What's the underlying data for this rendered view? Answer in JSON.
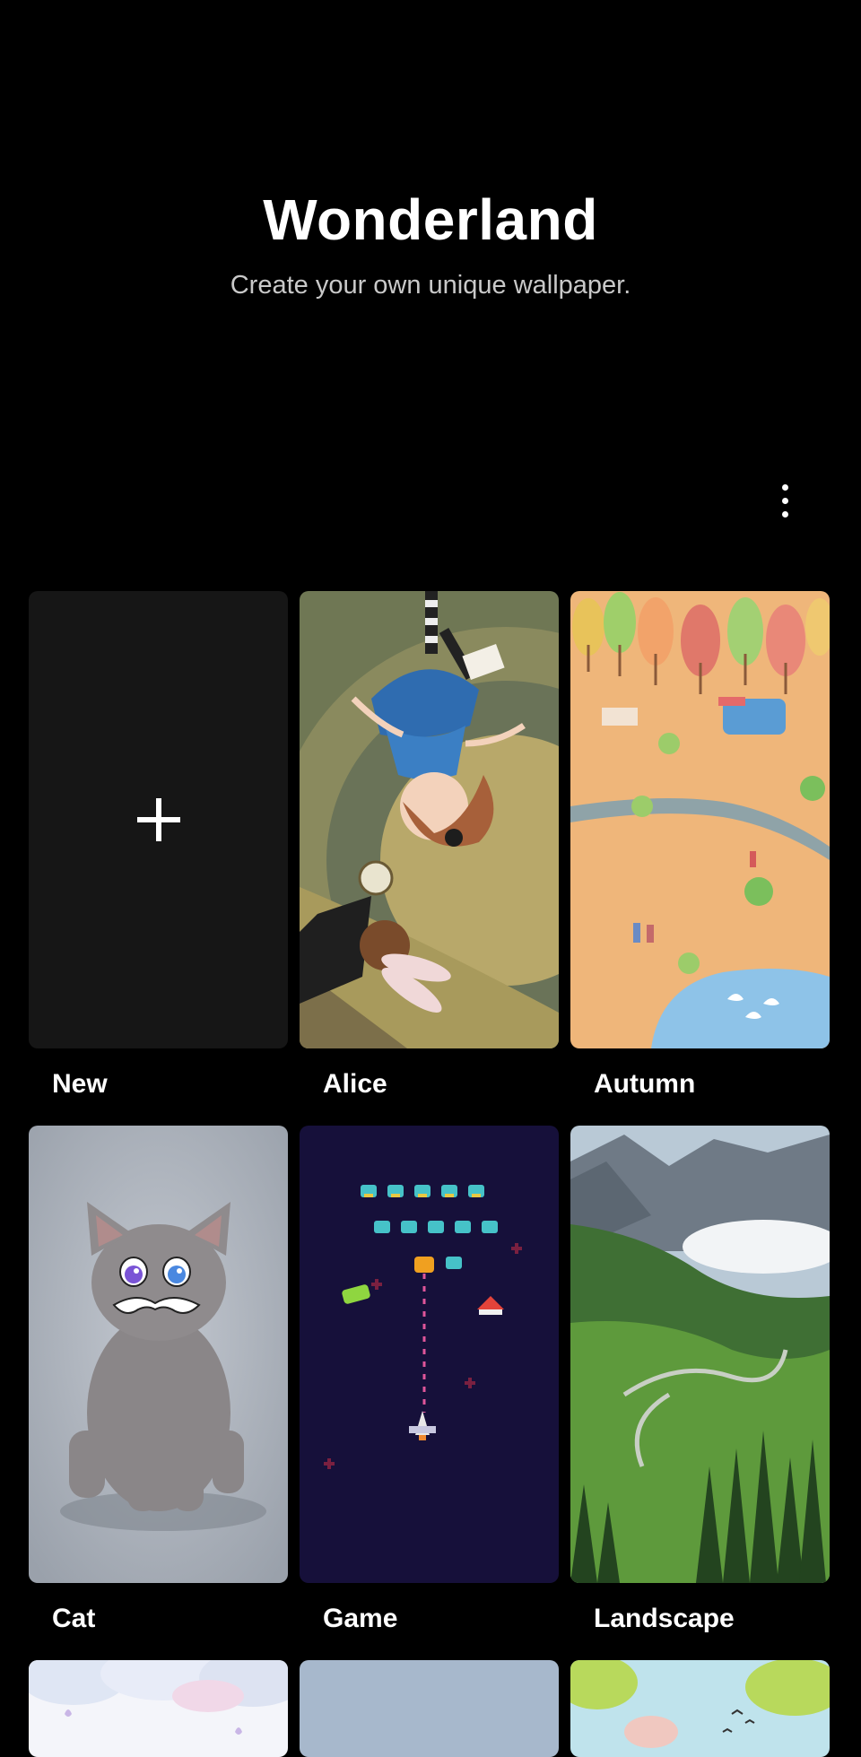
{
  "header": {
    "title": "Wonderland",
    "subtitle": "Create your own unique wallpaper."
  },
  "menu": {
    "icon": "more-vert-icon"
  },
  "wallpapers": [
    {
      "label": "New",
      "icon": "plus-icon"
    },
    {
      "label": "Alice"
    },
    {
      "label": "Autumn"
    },
    {
      "label": "Cat"
    },
    {
      "label": "Game"
    },
    {
      "label": "Landscape"
    }
  ],
  "colors": {
    "background": "#000000",
    "tile_new": "#161616",
    "subtitle": "#c9c9c9"
  }
}
